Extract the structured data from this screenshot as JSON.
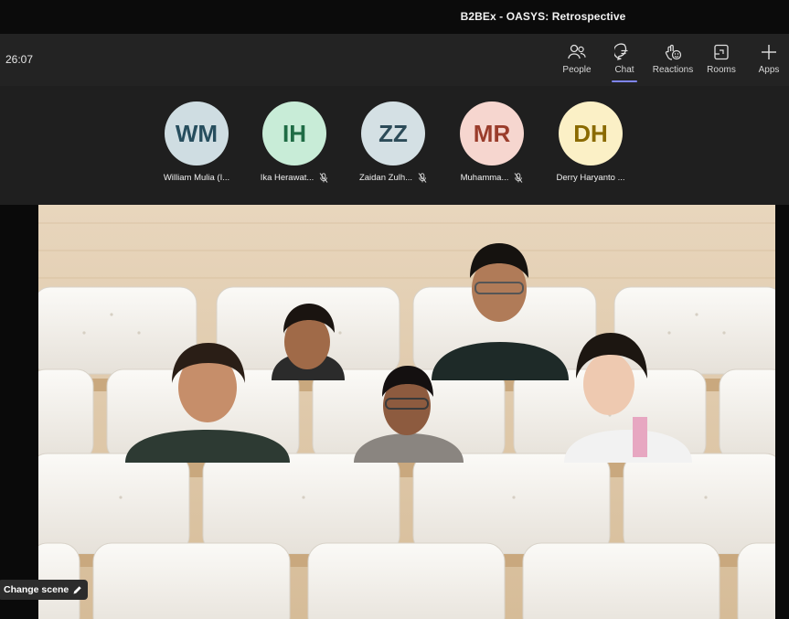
{
  "meeting": {
    "title": "B2BEx - OASYS: Retrospective",
    "timer": "26:07"
  },
  "toolbar": {
    "buttons": [
      {
        "label": "People",
        "icon": "people-icon",
        "active": false
      },
      {
        "label": "Chat",
        "icon": "chat-icon",
        "active": true
      },
      {
        "label": "Reactions",
        "icon": "reactions-icon",
        "active": false
      },
      {
        "label": "Rooms",
        "icon": "rooms-icon",
        "active": false
      },
      {
        "label": "Apps",
        "icon": "plus-icon",
        "active": false
      }
    ]
  },
  "participants": [
    {
      "initials": "WM",
      "name": "William Mulia (I...",
      "muted": false,
      "bg": "#cfdde2",
      "fg": "#274e5e"
    },
    {
      "initials": "IH",
      "name": "Ika Herawat...",
      "muted": true,
      "bg": "#c8ecd7",
      "fg": "#1f6c45"
    },
    {
      "initials": "ZZ",
      "name": "Zaidan Zulh...",
      "muted": true,
      "bg": "#d4e0e4",
      "fg": "#2c4b58"
    },
    {
      "initials": "MR",
      "name": "Muhamma...",
      "muted": true,
      "bg": "#f6d6cf",
      "fg": "#9a3c2b"
    },
    {
      "initials": "DH",
      "name": "Derry Haryanto ...",
      "muted": false,
      "bg": "#fbf0c6",
      "fg": "#8a6a00"
    }
  ],
  "stage": {
    "scene_button": "Change scene",
    "scene_icon": "pencil-icon"
  }
}
